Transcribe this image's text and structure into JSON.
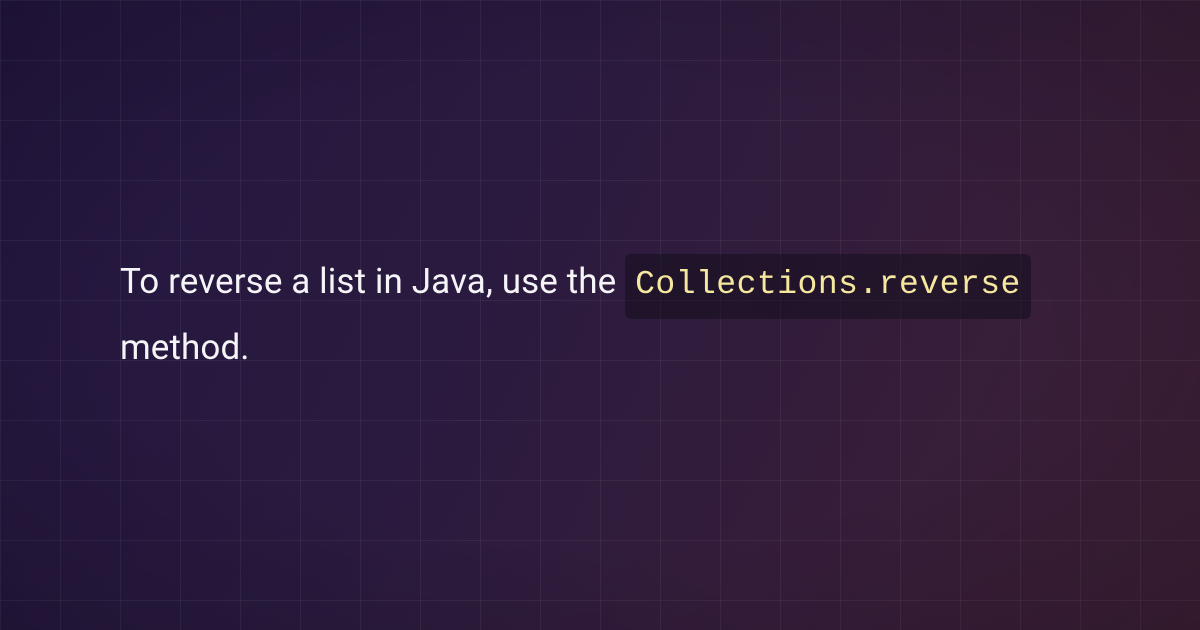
{
  "text": {
    "prefix": "To reverse a list in Java, use the ",
    "code": "Collections.reverse",
    "suffix": " method."
  }
}
